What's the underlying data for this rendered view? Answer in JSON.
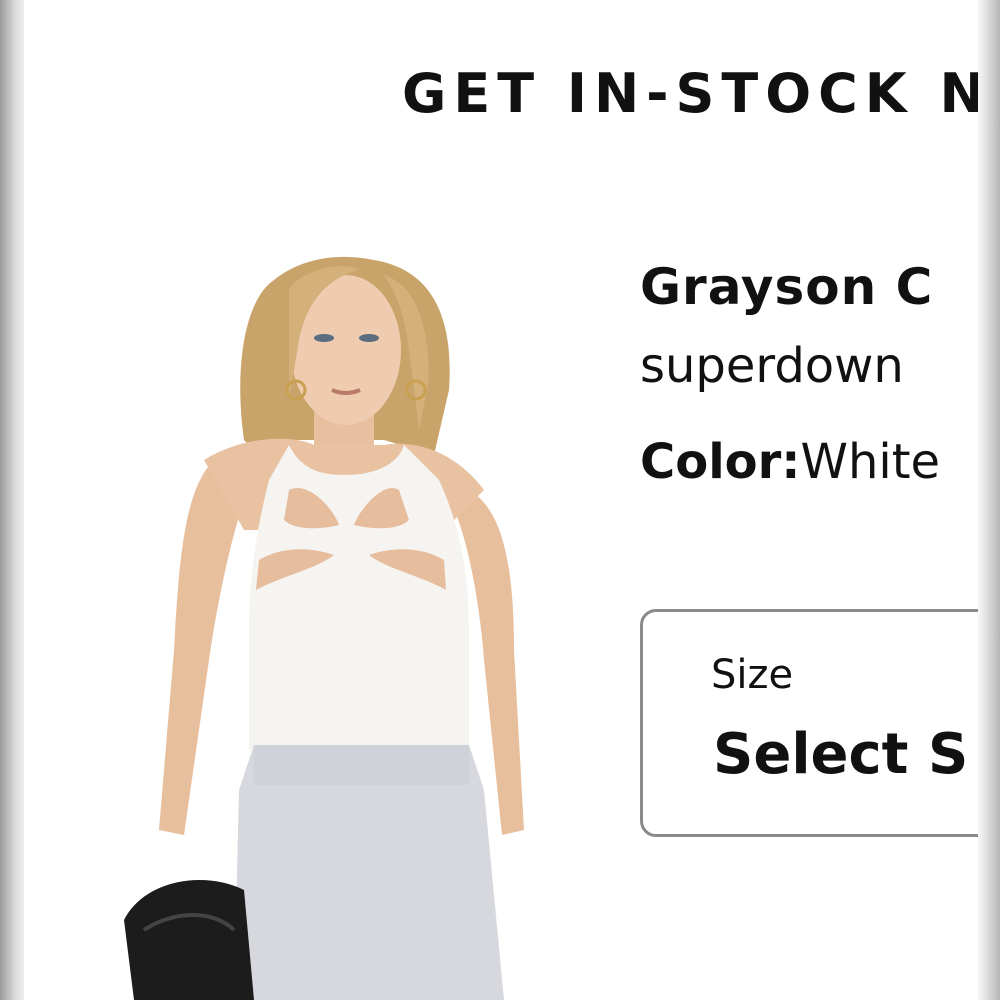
{
  "banner": {
    "notify_text": "GET IN-STOCK N"
  },
  "product": {
    "name": "Grayson C",
    "brand": "superdown",
    "color_label": "Color:",
    "color_value": "White"
  },
  "size_selector": {
    "label": "Size",
    "value": "Select S"
  },
  "image": {
    "subject": "model wearing white cutout halter top, gray sweat shorts, black bag"
  }
}
